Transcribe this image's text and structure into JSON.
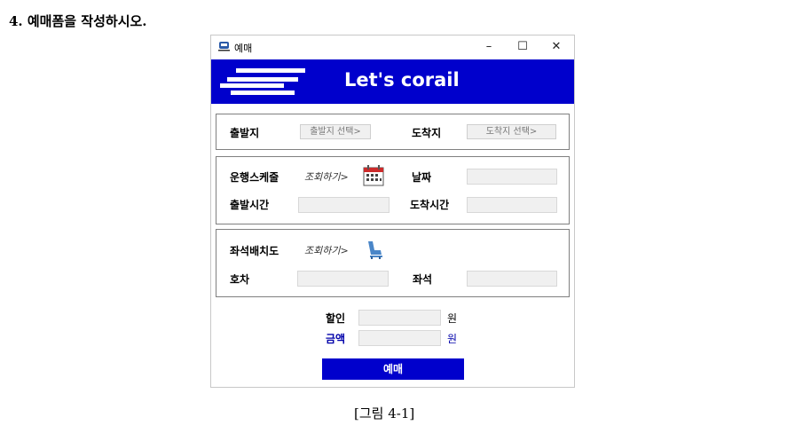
{
  "question": "4. 예매폼을 작성하시오.",
  "window": {
    "title": "예매",
    "minimize": "–",
    "maximize": "☐",
    "close": "✕"
  },
  "banner": {
    "text": "Let's corail"
  },
  "route": {
    "departure_label": "출발지",
    "departure_button": "출발지 선택>",
    "arrival_label": "도착지",
    "arrival_button": "도착지 선택>"
  },
  "schedule": {
    "schedule_label": "운행스케줄",
    "schedule_link": "조회하기>",
    "date_label": "날짜",
    "departure_time_label": "출발시간",
    "arrival_time_label": "도착시간"
  },
  "seat": {
    "seatmap_label": "좌석배치도",
    "seatmap_link": "조회하기>",
    "car_label": "호차",
    "seat_label": "좌석"
  },
  "payment": {
    "discount_label": "할인",
    "discount_unit": "원",
    "amount_label": "금액",
    "amount_unit": "원",
    "reserve_button": "예매"
  },
  "caption": "[그림 4-1]",
  "colors": {
    "brand": "#0000cc",
    "amount": "#0000aa",
    "icon_red": "#cc2b2b",
    "icon_blue": "#4a86c8"
  }
}
